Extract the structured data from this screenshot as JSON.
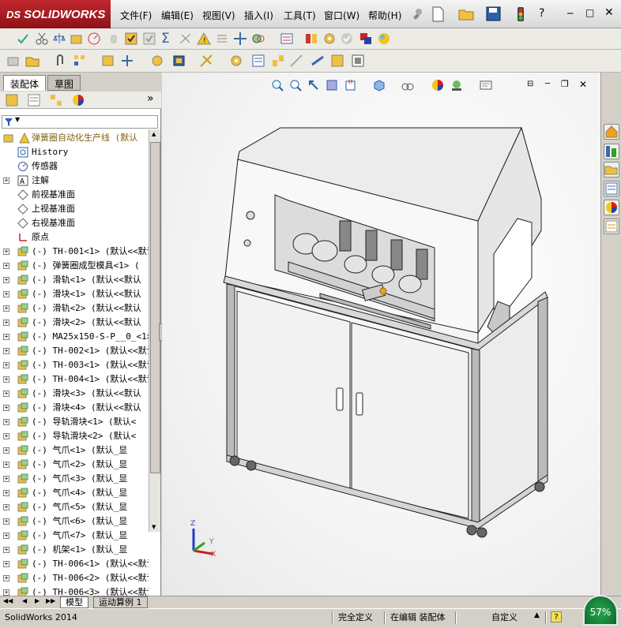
{
  "app": {
    "brand": "SOLIDWORKS",
    "menu": [
      "文件(F)",
      "编辑(E)",
      "视图(V)",
      "插入(I)",
      "工具(T)",
      "窗口(W)",
      "帮助(H)"
    ],
    "accent": "#c0282e"
  },
  "panel": {
    "tabs": [
      "装配体",
      "草图"
    ],
    "filter_symbol": "▼",
    "collapse_symbol": "»"
  },
  "tree": {
    "root": "弹簧圈自动化生产线 (默认",
    "items": [
      {
        "label": "History",
        "icon": "history-icon"
      },
      {
        "label": "传感器",
        "icon": "sensor-icon"
      },
      {
        "label": "注解",
        "icon": "annotation-icon"
      },
      {
        "label": "前视基准面",
        "icon": "plane-icon"
      },
      {
        "label": "上视基准面",
        "icon": "plane-icon"
      },
      {
        "label": "右视基准面",
        "icon": "plane-icon"
      },
      {
        "label": "原点",
        "icon": "origin-icon"
      },
      {
        "label": "(-) TH-001<1> (默认<<默认",
        "icon": "part-icon"
      },
      {
        "label": "(-) 弹簧圈成型模具<1> (",
        "icon": "part-icon"
      },
      {
        "label": "(-) 滑轨<1> (默认<<默认",
        "icon": "part-icon"
      },
      {
        "label": "(-) 滑块<1> (默认<<默认",
        "icon": "part-icon"
      },
      {
        "label": "(-) 滑轨<2> (默认<<默认",
        "icon": "part-icon"
      },
      {
        "label": "(-) 滑块<2> (默认<<默认",
        "icon": "part-icon"
      },
      {
        "label": "(-) MA25x150-S-P__0_<1>",
        "icon": "part-icon"
      },
      {
        "label": "(-) TH-002<1> (默认<<默认",
        "icon": "part-icon"
      },
      {
        "label": "(-) TH-003<1> (默认<<默认",
        "icon": "part-icon"
      },
      {
        "label": "(-) TH-004<1> (默认<<默认",
        "icon": "part-icon"
      },
      {
        "label": "(-) 滑块<3> (默认<<默认",
        "icon": "part-icon"
      },
      {
        "label": "(-) 滑块<4> (默认<<默认",
        "icon": "part-icon"
      },
      {
        "label": "(-) 导轨滑块<1> (默认<",
        "icon": "part-icon"
      },
      {
        "label": "(-) 导轨滑块<2> (默认<",
        "icon": "part-icon"
      },
      {
        "label": "(-) 气爪<1> (默认_显",
        "icon": "part-icon"
      },
      {
        "label": "(-) 气爪<2> (默认_显",
        "icon": "part-icon"
      },
      {
        "label": "(-) 气爪<3> (默认_显",
        "icon": "part-icon"
      },
      {
        "label": "(-) 气爪<4> (默认_显",
        "icon": "part-icon"
      },
      {
        "label": "(-) 气爪<5> (默认_显",
        "icon": "part-icon"
      },
      {
        "label": "(-) 气爪<6> (默认_显",
        "icon": "part-icon"
      },
      {
        "label": "(-) 气爪<7> (默认_显",
        "icon": "part-icon"
      },
      {
        "label": "(-) 机架<1> (默认_显",
        "icon": "part-icon"
      },
      {
        "label": "(-) TH-006<1> (默认<<默认",
        "icon": "part-icon"
      },
      {
        "label": "(-) TH-006<2> (默认<<默认",
        "icon": "part-icon"
      },
      {
        "label": "(-) TH-006<3> (默认<<默认",
        "icon": "part-icon"
      }
    ]
  },
  "bottom_tabs": [
    "模型",
    "运动算例 1"
  ],
  "status": {
    "app_version": "SolidWorks 2014",
    "defined": "完全定义",
    "editing": "在编辑 装配体",
    "units": "自定义",
    "help": "?",
    "gauge": "57%"
  },
  "triad": {
    "x": "X",
    "y": "Y",
    "z": "Z"
  }
}
